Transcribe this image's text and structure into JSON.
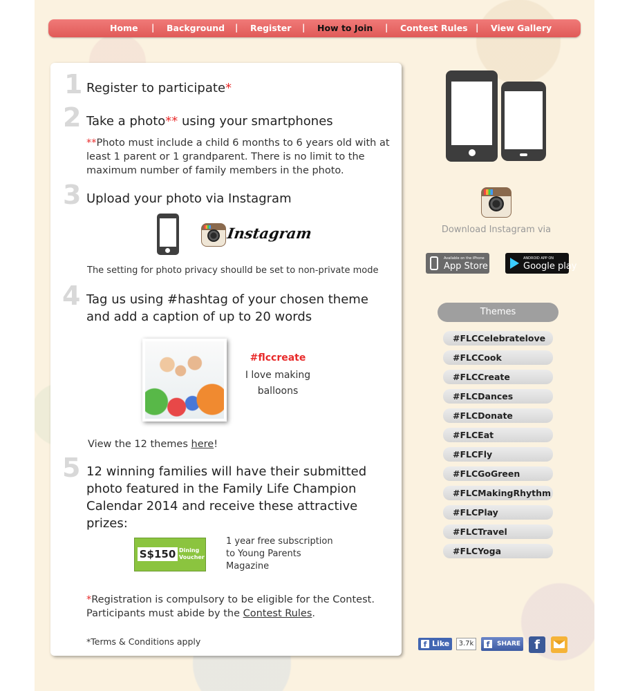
{
  "nav": {
    "items": [
      "Home",
      "Background",
      "Register",
      "How to Join",
      "Contest Rules",
      "View Gallery"
    ],
    "active": "How to Join",
    "separator": "|"
  },
  "steps": {
    "s1": {
      "num": "1",
      "text": "Register to participate",
      "mark": "*"
    },
    "s2": {
      "num": "2",
      "pre": "Take a photo",
      "mark": "**",
      "post": " using your smartphones",
      "note_mark": "**",
      "note": "Photo must include a child 6 months to 6 years old with at least 1 parent or 1 grandparent. There is no limit to the maximum number of family members in the photo."
    },
    "s3": {
      "num": "3",
      "text": "Upload your photo via Instagram",
      "instagram_word": "Instagram",
      "note": "The setting for photo privacy shoulld be set to non-private mode"
    },
    "s4": {
      "num": "4",
      "text": "Tag us using #hashtag of your chosen theme and add a caption of up to 20 words",
      "example_tag": "#flccreate",
      "example_caption": "I love making balloons",
      "themes_pre": "View the 12 themes ",
      "themes_link": "here",
      "themes_post": "!"
    },
    "s5": {
      "num": "5",
      "text": "12 winning families will have their submitted photo featured in the Family Life Champion Calendar 2014 and receive these attractive prizes:",
      "voucher_amount": "S$150",
      "voucher_label_1": "Dining",
      "voucher_label_2": "Voucher",
      "prize_2": "1 year free subscription to Young Parents Magazine"
    }
  },
  "footer_note": {
    "mark": "*",
    "pre": "Registration is compulsory to be eligible for the Contest. Participants must abide by the ",
    "link": "Contest Rules",
    "post": "."
  },
  "terms": "*Terms & Conditions apply",
  "sidebar": {
    "download_text": "Download Instagram via",
    "appstore_small": "Available on the iPhone",
    "appstore_big": "App Store",
    "googleplay_small": "ANDROID APP ON",
    "googleplay_big": "Google play",
    "themes_title": "Themes",
    "themes": [
      "#FLCCelebratelove",
      "#FLCCook",
      "#FLCCreate",
      "#FLCDances",
      "#FLCDonate",
      "#FLCEat",
      "#FLCFly",
      "#FLCGoGreen",
      "#FLCMakingRhythm",
      "#FLCPlay",
      "#FLCTravel",
      "#FLCYoga"
    ]
  },
  "social": {
    "like_label": "Like",
    "like_count": "3.7k",
    "share_label": "SHARE",
    "fb_letter": "f"
  },
  "colors": {
    "nav": "#e86866",
    "accent_red": "#e82a2a",
    "voucher_green": "#8bc43f",
    "page_bg": "#fbf2e0"
  },
  "icons": [
    "smartphone-icon",
    "instagram-icon",
    "facebook-icon",
    "mail-icon",
    "apple-icon",
    "google-play-icon"
  ]
}
